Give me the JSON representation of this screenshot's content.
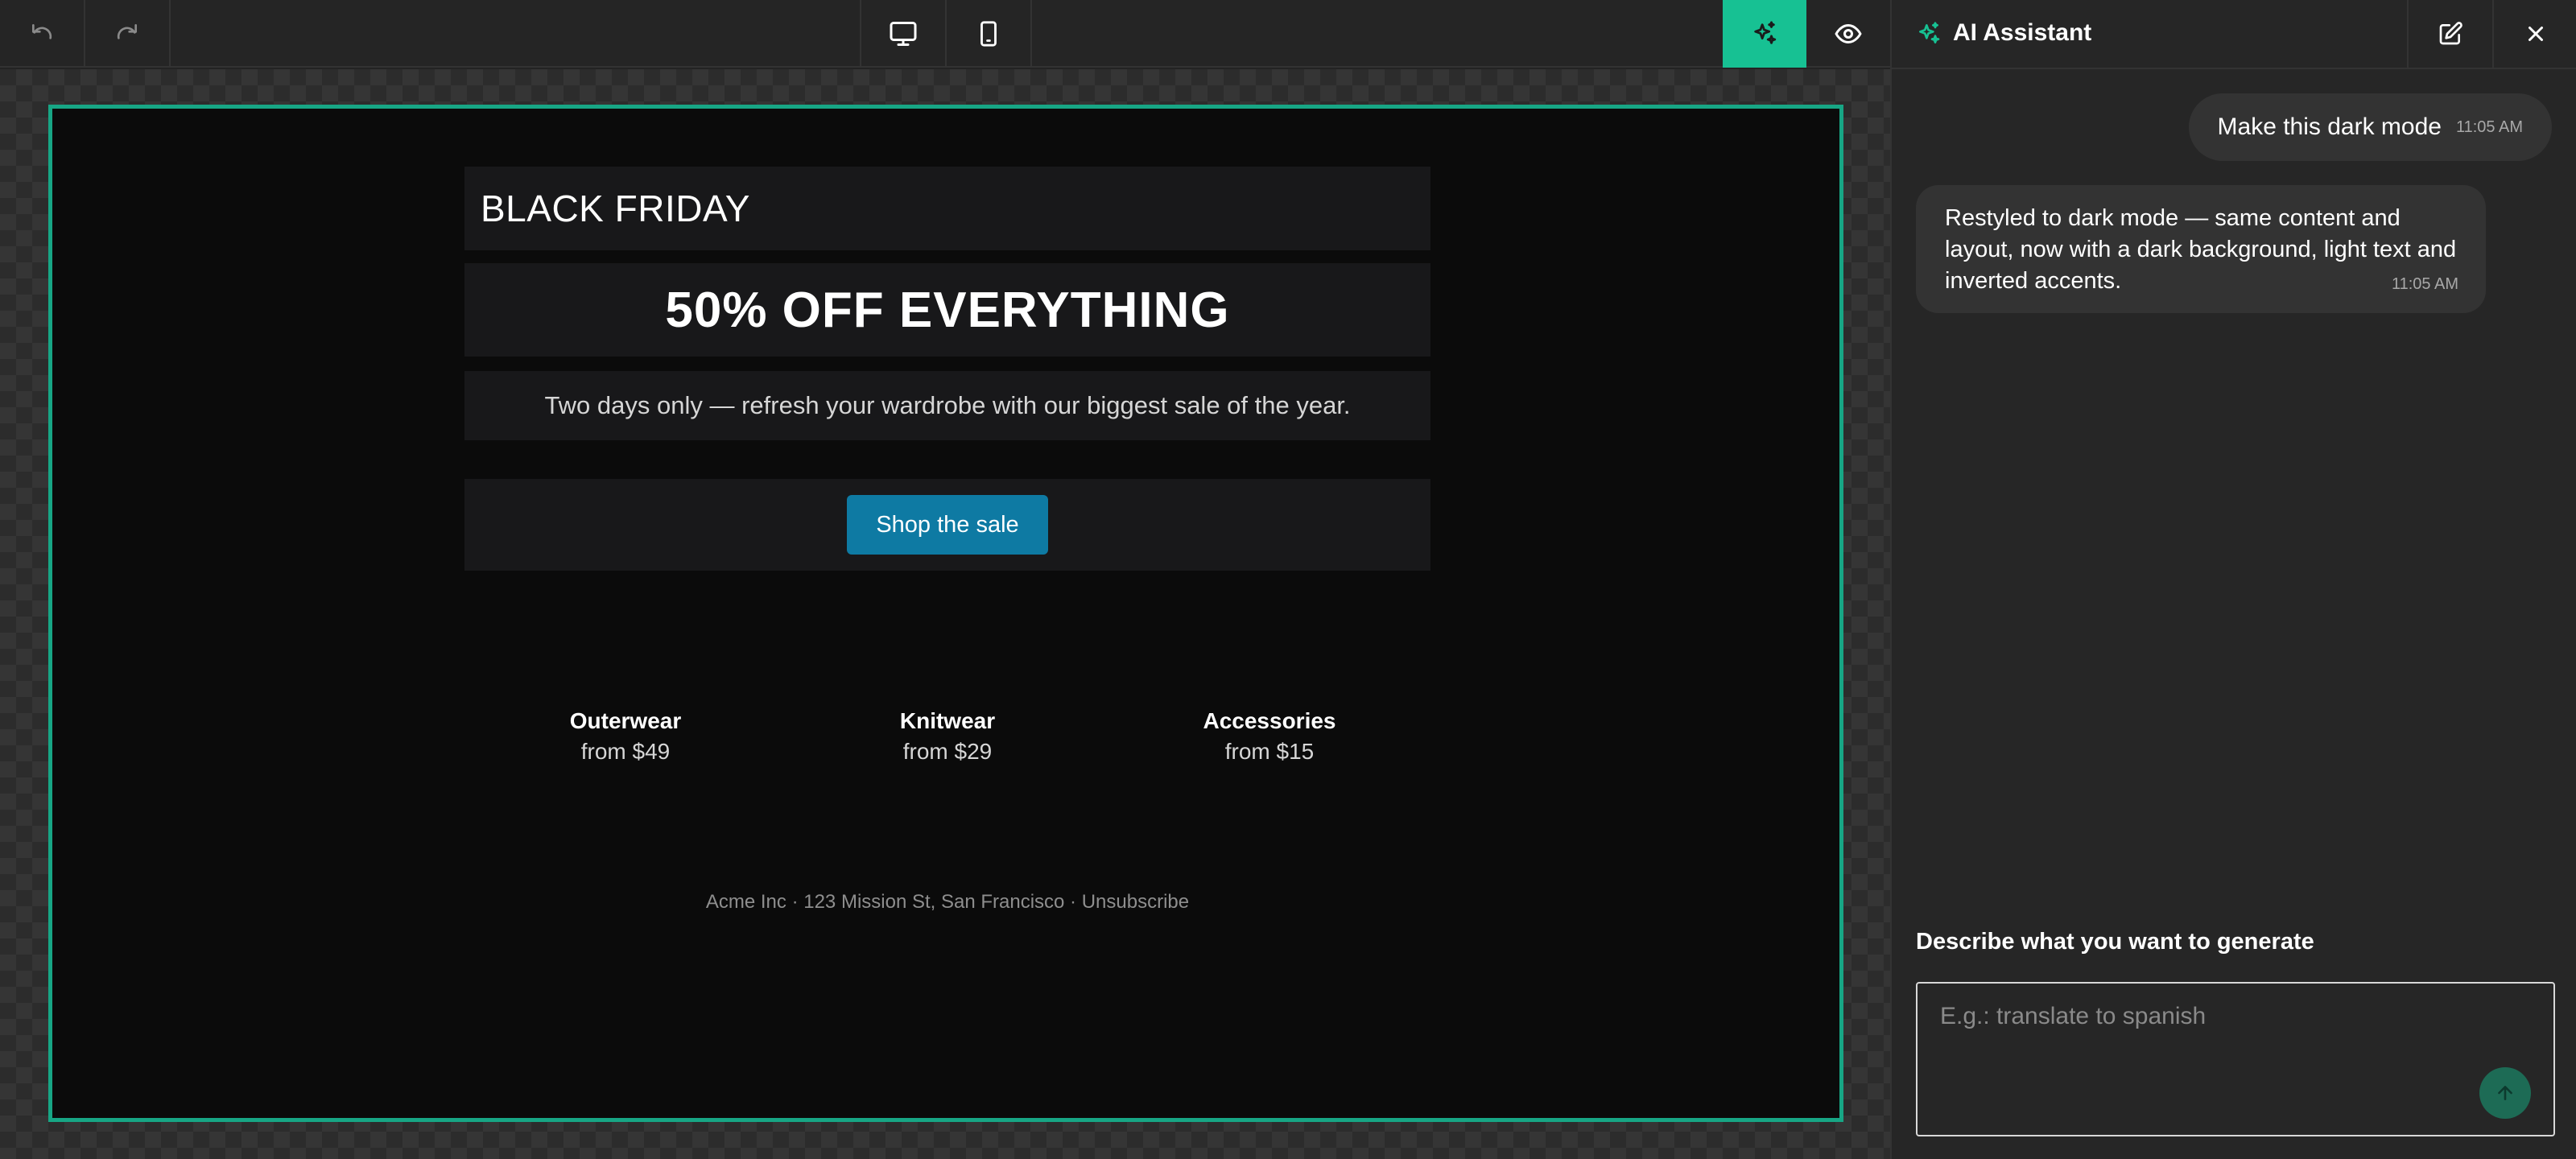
{
  "toolbar": {
    "undo_icon": "undo-icon",
    "redo_icon": "redo-icon",
    "desktop_icon": "desktop-icon",
    "mobile_icon": "mobile-icon",
    "ai_icon": "sparkles-icon",
    "preview_icon": "eye-icon",
    "accent_color": "#17a685"
  },
  "email": {
    "heading": "BLACK FRIDAY",
    "title": "50% OFF EVERYTHING",
    "subtitle": "Two days only — refresh your wardrobe with our biggest sale of the year.",
    "cta_label": "Shop the sale",
    "cta_color": "#0e7aa3",
    "categories": [
      {
        "name": "Outerwear",
        "price": "from $49"
      },
      {
        "name": "Knitwear",
        "price": "from $29"
      },
      {
        "name": "Accessories",
        "price": "from $15"
      }
    ],
    "footer": "Acme Inc · 123 Mission St, San Francisco · Unsubscribe"
  },
  "assistant": {
    "title": "AI Assistant",
    "messages": [
      {
        "role": "user",
        "text": "Make this dark mode",
        "time": "11:05 AM"
      },
      {
        "role": "assistant",
        "text": "Restyled to dark mode — same content and layout, now with a dark background, light text and inverted accents.",
        "time": "11:05 AM"
      }
    ],
    "prompt_label": "Describe what you want to generate",
    "prompt_placeholder": "E.g.: translate to spanish"
  }
}
